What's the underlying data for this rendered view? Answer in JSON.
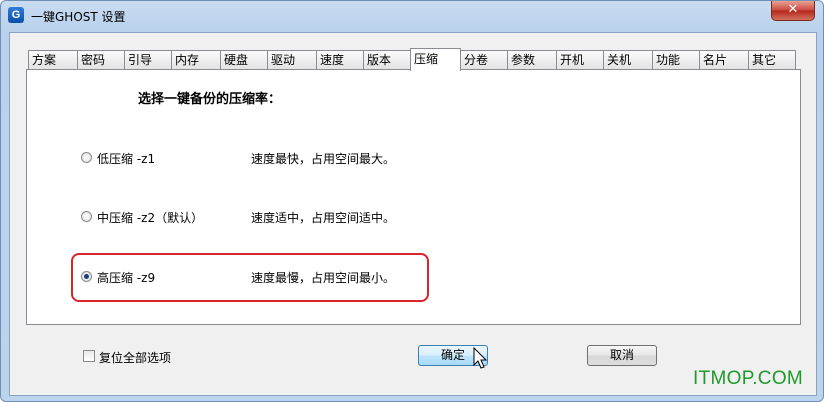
{
  "window": {
    "title": "一键GHOST 设置",
    "icon_letter": "G",
    "close_glyph": "✕"
  },
  "tabs": [
    {
      "label": "方案"
    },
    {
      "label": "密码"
    },
    {
      "label": "引导"
    },
    {
      "label": "内存"
    },
    {
      "label": "硬盘"
    },
    {
      "label": "驱动"
    },
    {
      "label": "速度"
    },
    {
      "label": "版本"
    },
    {
      "label": "压缩",
      "active": true
    },
    {
      "label": "分卷"
    },
    {
      "label": "参数"
    },
    {
      "label": "开机"
    },
    {
      "label": "关机"
    },
    {
      "label": "功能"
    },
    {
      "label": "名片"
    },
    {
      "label": "其它"
    }
  ],
  "panel": {
    "title": "选择一键备份的压缩率：",
    "options": [
      {
        "label": "低压缩 -z1",
        "description": "速度最快，占用空间最大。",
        "selected": false
      },
      {
        "label": "中压缩 -z2（默认）",
        "description": "速度适中，占用空间适中。",
        "selected": false
      },
      {
        "label": "高压缩 -z9",
        "description": "速度最慢，占用空间最小。",
        "selected": true
      }
    ]
  },
  "footer": {
    "reset_label": "复位全部选项",
    "reset_checked": false,
    "ok_label": "确定",
    "cancel_label": "取消"
  },
  "watermark": "ITMOP.COM",
  "colors": {
    "highlight": "#d8242c",
    "watermark": "#1e9a2c",
    "titlebar": "#bcd3ec"
  }
}
